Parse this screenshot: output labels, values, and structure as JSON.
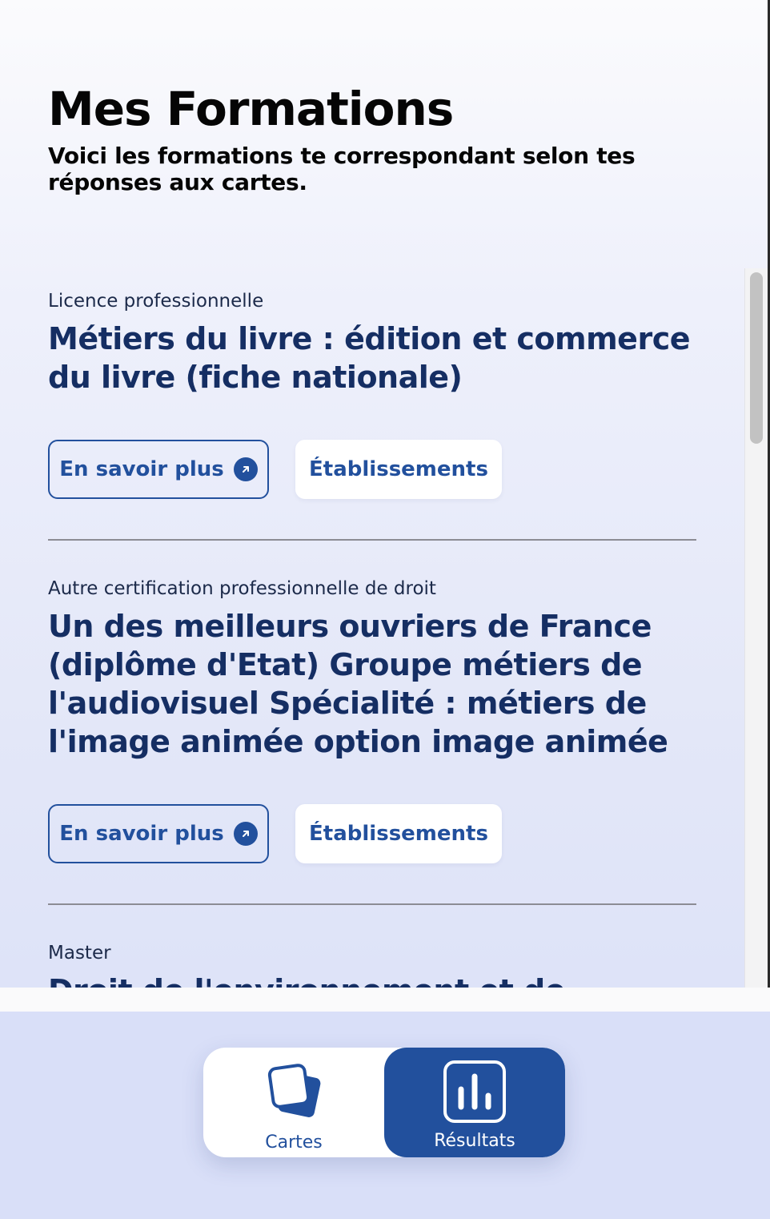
{
  "header": {
    "title": "Mes Formations",
    "subtitle": "Voici les formations te correspondant selon tes réponses aux cartes."
  },
  "formations": [
    {
      "type": "Licence professionnelle",
      "title": "Métiers du livre : édition et commerce du livre (fiche nationale)",
      "more_label": "En savoir plus",
      "establishments_label": "Établissements"
    },
    {
      "type": "Autre certification professionnelle de droit",
      "title": "Un des meilleurs ouvriers de France (diplôme d'Etat) Groupe métiers de l'audiovisuel Spécialité : métiers de l'image animée option image animée",
      "more_label": "En savoir plus",
      "establishments_label": "Établissements"
    },
    {
      "type": "Master",
      "title": "Droit de l'environnement et de"
    }
  ],
  "nav": {
    "cartes_label": "Cartes",
    "resultats_label": "Résultats",
    "active": "Résultats"
  },
  "colors": {
    "brand": "#22509d",
    "title_text": "#152e63",
    "nav_background": "#d9dff8"
  },
  "icons": {
    "more_button": "arrow-up-right-circle-icon",
    "cartes": "cards-stack-icon",
    "resultats": "bar-chart-icon"
  }
}
